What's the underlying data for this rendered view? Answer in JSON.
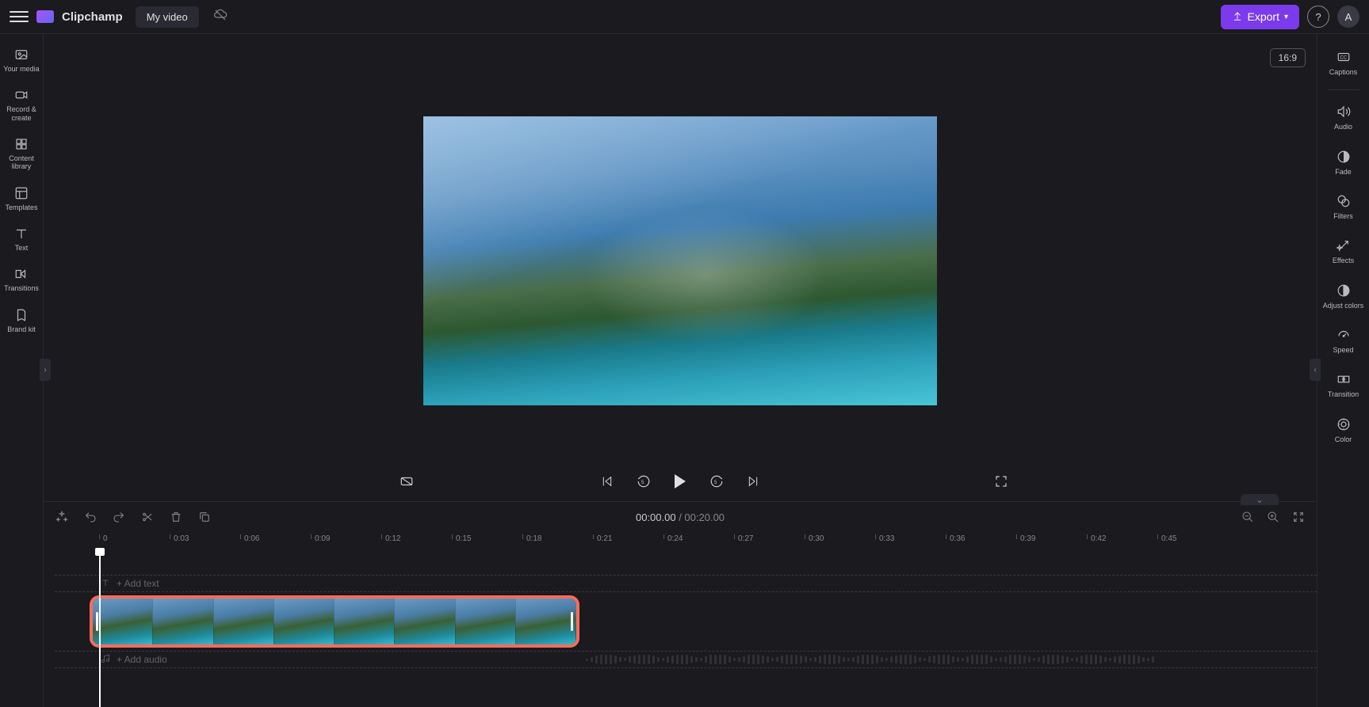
{
  "header": {
    "app_name": "Clipchamp",
    "video_title": "My video",
    "export_label": "Export",
    "aspect_ratio": "16:9",
    "avatar_letter": "A"
  },
  "left_sidebar": {
    "items": [
      {
        "label": "Your media",
        "icon": "media-icon"
      },
      {
        "label": "Record & create",
        "icon": "record-icon"
      },
      {
        "label": "Content library",
        "icon": "library-icon"
      },
      {
        "label": "Templates",
        "icon": "templates-icon"
      },
      {
        "label": "Text",
        "icon": "text-icon"
      },
      {
        "label": "Transitions",
        "icon": "transitions-icon"
      },
      {
        "label": "Brand kit",
        "icon": "brandkit-icon"
      }
    ]
  },
  "right_sidebar": {
    "items": [
      {
        "label": "Captions",
        "icon": "captions-icon"
      },
      {
        "label": "Audio",
        "icon": "audio-icon"
      },
      {
        "label": "Fade",
        "icon": "fade-icon"
      },
      {
        "label": "Filters",
        "icon": "filters-icon"
      },
      {
        "label": "Effects",
        "icon": "effects-icon"
      },
      {
        "label": "Adjust colors",
        "icon": "adjust-colors-icon"
      },
      {
        "label": "Speed",
        "icon": "speed-icon"
      },
      {
        "label": "Transition",
        "icon": "transition-icon"
      },
      {
        "label": "Color",
        "icon": "color-icon"
      }
    ]
  },
  "timeline": {
    "current_time": "00:00.00",
    "duration": "00:20.00",
    "add_text_label": "+ Add text",
    "add_audio_label": "+ Add audio",
    "ticks": [
      "0",
      "0:03",
      "0:06",
      "0:09",
      "0:12",
      "0:15",
      "0:18",
      "0:21",
      "0:24",
      "0:27",
      "0:30",
      "0:33",
      "0:36",
      "0:39",
      "0:42",
      "0:45"
    ]
  }
}
